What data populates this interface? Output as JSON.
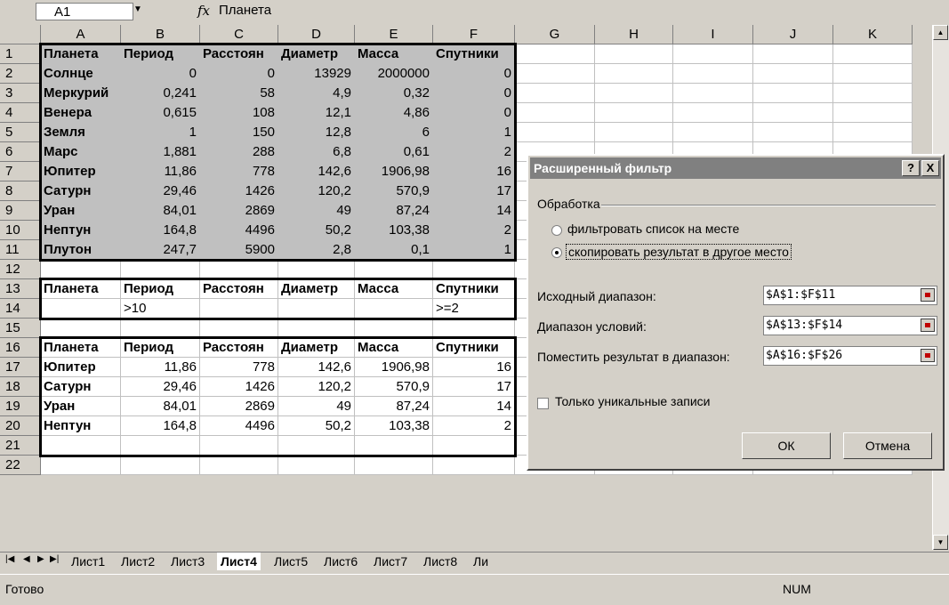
{
  "formula_bar": {
    "name_box": "A1",
    "fx": "fx",
    "value": "Планета"
  },
  "columns": [
    "A",
    "B",
    "C",
    "D",
    "E",
    "F",
    "G",
    "H",
    "I",
    "J",
    "K"
  ],
  "rows": [
    "1",
    "2",
    "3",
    "4",
    "5",
    "6",
    "7",
    "8",
    "9",
    "10",
    "11",
    "12",
    "13",
    "14",
    "15",
    "16",
    "17",
    "18",
    "19",
    "20",
    "21",
    "22"
  ],
  "source_table": {
    "header": [
      "Планета",
      "Период",
      "Расстоян",
      "Диаметр",
      "Масса",
      "Спутники"
    ],
    "rows": [
      [
        "Солнце",
        "0",
        "0",
        "13929",
        "2000000",
        "0"
      ],
      [
        "Меркурий",
        "0,241",
        "58",
        "4,9",
        "0,32",
        "0"
      ],
      [
        "Венера",
        "0,615",
        "108",
        "12,1",
        "4,86",
        "0"
      ],
      [
        "Земля",
        "1",
        "150",
        "12,8",
        "6",
        "1"
      ],
      [
        "Марс",
        "1,881",
        "288",
        "6,8",
        "0,61",
        "2"
      ],
      [
        "Юпитер",
        "11,86",
        "778",
        "142,6",
        "1906,98",
        "16"
      ],
      [
        "Сатурн",
        "29,46",
        "1426",
        "120,2",
        "570,9",
        "17"
      ],
      [
        "Уран",
        "84,01",
        "2869",
        "49",
        "87,24",
        "14"
      ],
      [
        "Нептун",
        "164,8",
        "4496",
        "50,2",
        "103,38",
        "2"
      ],
      [
        "Плутон",
        "247,7",
        "5900",
        "2,8",
        "0,1",
        "1"
      ]
    ]
  },
  "criteria_table": {
    "header": [
      "Планета",
      "Период",
      "Расстоян",
      "Диаметр",
      "Масса",
      "Спутники"
    ],
    "row": [
      "",
      ">10",
      "",
      "",
      "",
      ">=2"
    ]
  },
  "result_table": {
    "header": [
      "Планета",
      "Период",
      "Расстоян",
      "Диаметр",
      "Масса",
      "Спутники"
    ],
    "rows": [
      [
        "Юпитер",
        "11,86",
        "778",
        "142,6",
        "1906,98",
        "16"
      ],
      [
        "Сатурн",
        "29,46",
        "1426",
        "120,2",
        "570,9",
        "17"
      ],
      [
        "Уран",
        "84,01",
        "2869",
        "49",
        "87,24",
        "14"
      ],
      [
        "Нептун",
        "164,8",
        "4496",
        "50,2",
        "103,38",
        "2"
      ]
    ]
  },
  "sheet_tabs": [
    "Лист1",
    "Лист2",
    "Лист3",
    "Лист4",
    "Лист5",
    "Лист6",
    "Лист7",
    "Лист8",
    "Ли"
  ],
  "active_tab": "Лист4",
  "status": {
    "ready": "Готово",
    "num": "NUM"
  },
  "dialog": {
    "title": "Расширенный фильтр",
    "help": "?",
    "close": "X",
    "group_label": "Обработка",
    "radio_filter": "фильтровать список на месте",
    "radio_copy": "скопировать результат в другое место",
    "source_label": "Исходный диапазон:",
    "source_value": "$A$1:$F$11",
    "criteria_label": "Диапазон условий:",
    "criteria_value": "$A$13:$F$14",
    "dest_label": "Поместить результат в диапазон:",
    "dest_value": "$A$16:$F$26",
    "unique_label": "Только уникальные записи",
    "ok": "ОК",
    "cancel": "Отмена"
  }
}
